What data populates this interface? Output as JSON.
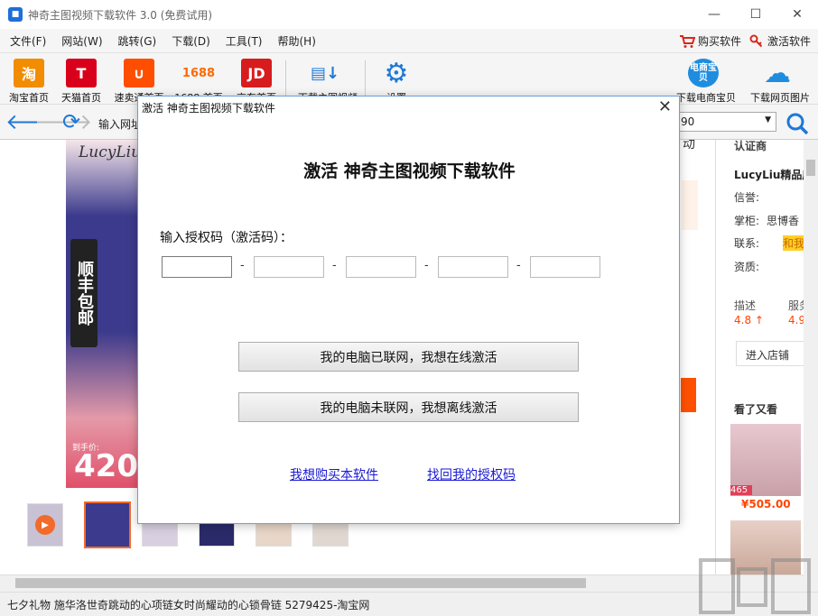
{
  "window": {
    "title": "神奇主图视频下载软件 3.0 (免费试用)",
    "app_icon_text": "■",
    "minimize": "—",
    "maximize": "☐",
    "close": "✕"
  },
  "menu": {
    "items": [
      "文件(F)",
      "网站(W)",
      "跳转(G)",
      "下载(D)",
      "工具(T)",
      "帮助(H)"
    ],
    "buy": "购买软件",
    "activate": "激活软件"
  },
  "toolbar": {
    "items": [
      {
        "logo": "淘",
        "label": "淘宝首页",
        "color": "#f28c00"
      },
      {
        "logo": "T",
        "label": "天猫首页",
        "color": "#d9001b"
      },
      {
        "logo": "∪",
        "label": "速卖通首页",
        "color": "#ff4e00"
      },
      {
        "logo": "1688",
        "label": "1688 首页",
        "color": "#ff6a00"
      },
      {
        "logo": "JD",
        "label": "京东首页",
        "color": "#d71c1e"
      },
      {
        "logo": "▤↓",
        "label": "下载主图视频",
        "color": "#1e78d8"
      },
      {
        "logo": "⚙",
        "label": "设置",
        "color": "#1e78d8"
      },
      {
        "logo": "电商宝贝",
        "label": "下载电商宝贝",
        "color": "#1e8de0"
      },
      {
        "logo": "☁",
        "label": "下载网页图片",
        "color": "#1e8de0"
      }
    ]
  },
  "nav": {
    "url_label": "输入网址",
    "combo_value": "90",
    "back": "🡐",
    "forward": "🡒",
    "refresh": "⟳"
  },
  "page": {
    "brand": "LucyLiu",
    "sf_text": "顺丰包邮",
    "price_label": "到手价:",
    "price": "420",
    "right_panel": {
      "cert": "认证商",
      "shop": "LucyLiu精品店",
      "reputation": "信誉:",
      "keeper_label": "掌柜:",
      "keeper": "思博香",
      "contact": "联系:",
      "contact_badge": "和我",
      "qual": "资质:",
      "desc": "描述",
      "serv": "服务",
      "desc_score": "4.8 ↑",
      "serv_score": "4.9",
      "enter_shop": "进入店铺",
      "also_viewed": "看了又看",
      "item1_badge": "465",
      "item_price": "¥505.00"
    },
    "top_right_fragment": "动"
  },
  "status": {
    "text": "七夕礼物 施华洛世奇跳动的心项链女时尚耀动的心锁骨链 5279425-淘宝网"
  },
  "dialog": {
    "title": "激活 神奇主图视频下载软件",
    "close": "✕",
    "heading": "激活 神奇主图视频下载软件",
    "code_label": "输入授权码（激活码）：",
    "code_fields": [
      "",
      "",
      "",
      "",
      ""
    ],
    "dash": "-",
    "online_btn": "我的电脑已联网，我想在线激活",
    "offline_btn": "我的电脑未联网，我想离线激活",
    "buy_link": "我想购买本软件",
    "retrieve_link": "找回我的授权码"
  }
}
